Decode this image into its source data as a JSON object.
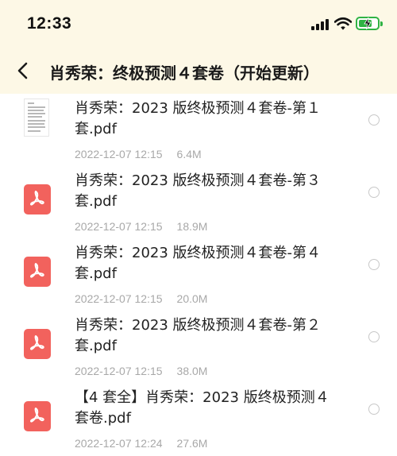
{
  "status_bar": {
    "time": "12:33"
  },
  "nav": {
    "title": "肖秀荣：终极预测４套卷（开始更新）"
  },
  "files": [
    {
      "name": "肖秀荣：2023 版终极预测４套卷-第１套.pdf",
      "date": "2022-12-07 12:15",
      "size": "6.4M",
      "icon": "document-thumbnail"
    },
    {
      "name": "肖秀荣：2023 版终极预测４套卷-第３套.pdf",
      "date": "2022-12-07 12:15",
      "size": "18.9M",
      "icon": "pdf-icon"
    },
    {
      "name": "肖秀荣：2023 版终极预测４套卷-第４套.pdf",
      "date": "2022-12-07 12:15",
      "size": "20.0M",
      "icon": "pdf-icon"
    },
    {
      "name": "肖秀荣：2023 版终极预测４套卷-第２套.pdf",
      "date": "2022-12-07 12:15",
      "size": "38.0M",
      "icon": "pdf-icon"
    },
    {
      "name": "【4 套全】肖秀荣：2023 版终极预测４套卷.pdf",
      "date": "2022-12-07 12:24",
      "size": "27.6M",
      "icon": "pdf-icon"
    }
  ],
  "colors": {
    "header_bg": "#fdf8e6",
    "pdf_red": "#f2625d",
    "battery_green": "#2fb344",
    "meta_gray": "#a8a8a8"
  }
}
